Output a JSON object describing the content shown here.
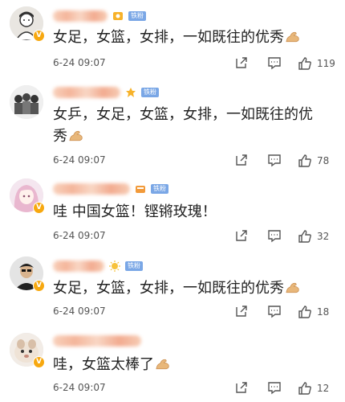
{
  "comments": [
    {
      "fan_badge": "铁粉",
      "text": "女足，女篮，女排，一如既往的优秀",
      "time": "6-24 09:07",
      "likes": "119",
      "avatar_icon": "person-avatar"
    },
    {
      "fan_badge": "铁粉",
      "text": "女乒，女足，女篮，女排，一如既往的优秀",
      "time": "6-24 09:07",
      "likes": "78",
      "avatar_icon": "group-avatar"
    },
    {
      "fan_badge": "铁粉",
      "text": "哇 中国女篮！铿锵玫瑰！",
      "time": "6-24 09:07",
      "likes": "32",
      "avatar_icon": "anime-girl-avatar"
    },
    {
      "fan_badge": "铁粉",
      "text": "女足，女篮，女排，一如既往的优秀",
      "time": "6-24 09:07",
      "likes": "18",
      "avatar_icon": "person-avatar"
    },
    {
      "fan_badge": "",
      "text": "哇，女篮太棒了",
      "time": "6-24 09:07",
      "likes": "12",
      "avatar_icon": "pet-avatar"
    }
  ],
  "icons": {
    "verified": "V",
    "emoji": "flexed-biceps-icon",
    "share": "share-icon",
    "comment": "comment-icon",
    "like": "thumbs-up-icon"
  }
}
